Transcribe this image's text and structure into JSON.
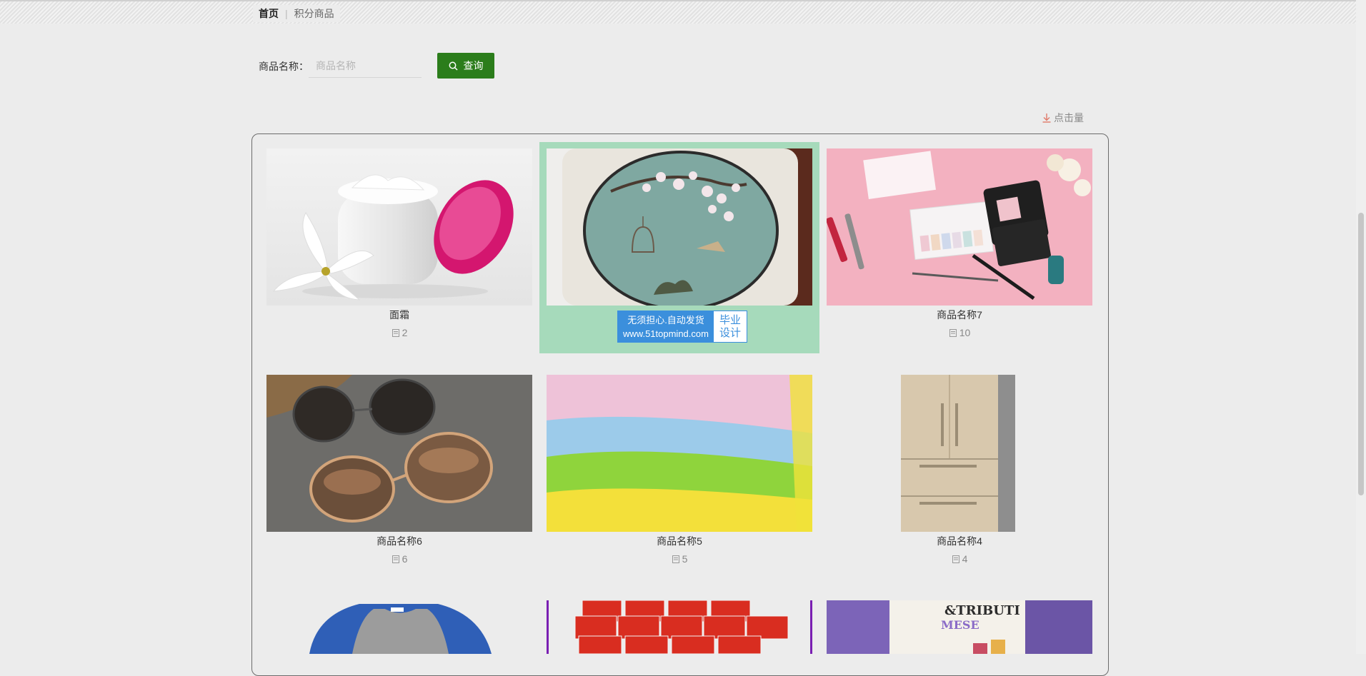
{
  "breadcrumb": {
    "home": "首页",
    "current": "积分商品"
  },
  "search": {
    "label": "商品名称：",
    "placeholder": "商品名称",
    "value": "",
    "button_label": "查询"
  },
  "sort": {
    "label": "点击量"
  },
  "colors": {
    "accent_green": "#2b7d1b",
    "highlight_bg": "#a6dabb",
    "promo_blue": "#3b8fdc"
  },
  "products": [
    {
      "name": "面霜",
      "clicks": "2",
      "image": "cream-jar-photo"
    },
    {
      "name": "",
      "clicks": "",
      "image": "embroidered-cushion-photo"
    },
    {
      "name": "商品名称7",
      "clicks": "10",
      "image": "makeup-palette-photo"
    },
    {
      "name": "商品名称6",
      "clicks": "6",
      "image": "sunglasses-photo"
    },
    {
      "name": "商品名称5",
      "clicks": "5",
      "image": "microfiber-towels-photo"
    },
    {
      "name": "商品名称4",
      "clicks": "4",
      "image": "refrigerator-photo"
    },
    {
      "name": "",
      "clicks": "",
      "image": "blue-shirt-photo"
    },
    {
      "name": "",
      "clicks": "",
      "image": "wangzai-milk-photo"
    },
    {
      "name": "",
      "clicks": "",
      "image": "magazine-cover-photo"
    }
  ],
  "promo": {
    "line1": "无须担心.自动发货",
    "line2": "www.51topmind.com",
    "badge_line1": "毕业",
    "badge_line2": "设计"
  },
  "magazine_text": {
    "title": "&TRIBUTI",
    "subtitle": "MESE"
  }
}
